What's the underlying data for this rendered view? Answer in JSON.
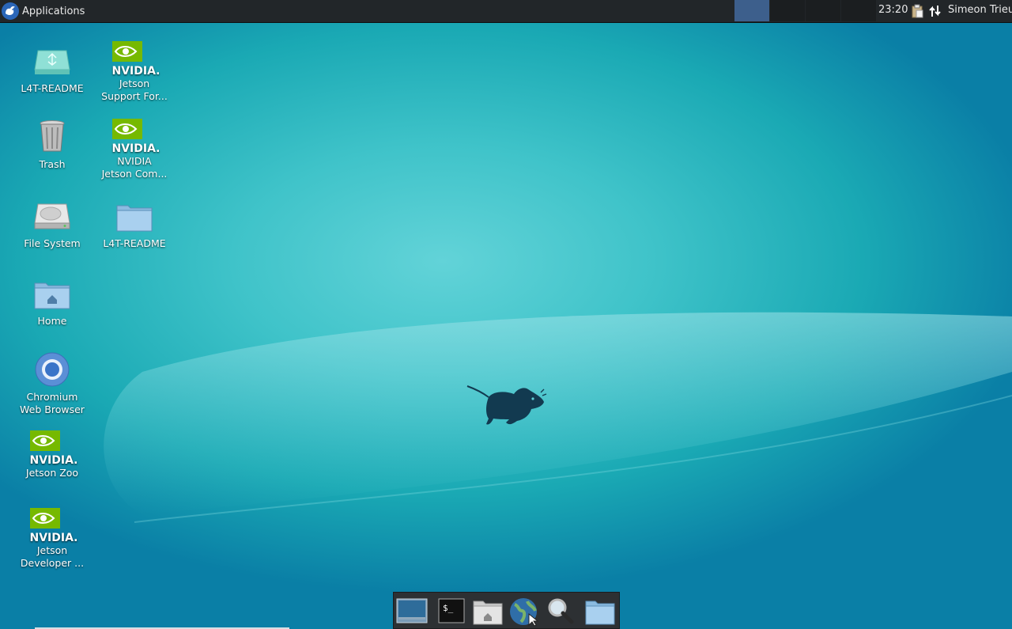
{
  "top_panel": {
    "applications_label": "Applications",
    "clock": "23:20",
    "user_name": "Simeon Trieu",
    "workspaces": [
      "1",
      "2",
      "3",
      "4"
    ],
    "active_workspace": "1"
  },
  "desktop": {
    "icons": [
      {
        "label": "L4T-README",
        "icon": "usb-drive-icon"
      },
      {
        "label": "Trash",
        "icon": "trash-icon"
      },
      {
        "label": "File System",
        "icon": "hard-drive-icon"
      },
      {
        "label": "Home",
        "icon": "home-folder-icon"
      },
      {
        "label": "Chromium\nWeb Browser",
        "icon": "chromium-icon"
      },
      {
        "label": "Jetson Zoo",
        "icon": "nvidia-icon"
      },
      {
        "label": "Jetson\nDeveloper ...",
        "icon": "nvidia-icon"
      },
      {
        "label": "Jetson\nSupport For...",
        "icon": "nvidia-icon"
      },
      {
        "label": "NVIDIA\nJetson Com...",
        "icon": "nvidia-icon"
      },
      {
        "label": "L4T-README",
        "icon": "folder-icon"
      }
    ],
    "nvidia_wordmark": "NVIDIA."
  },
  "dock": {
    "items": [
      {
        "icon": "show-desktop-icon"
      },
      {
        "icon": "terminal-icon",
        "glyph": "$_"
      },
      {
        "icon": "home-folder-icon"
      },
      {
        "icon": "web-browser-icon"
      },
      {
        "icon": "search-icon"
      },
      {
        "icon": "folder-icon"
      }
    ]
  },
  "colors": {
    "panel": "#222629",
    "active_workspace": "#3d5f8c",
    "nvidia_green": "#76b900",
    "mouse": "#123a50"
  }
}
